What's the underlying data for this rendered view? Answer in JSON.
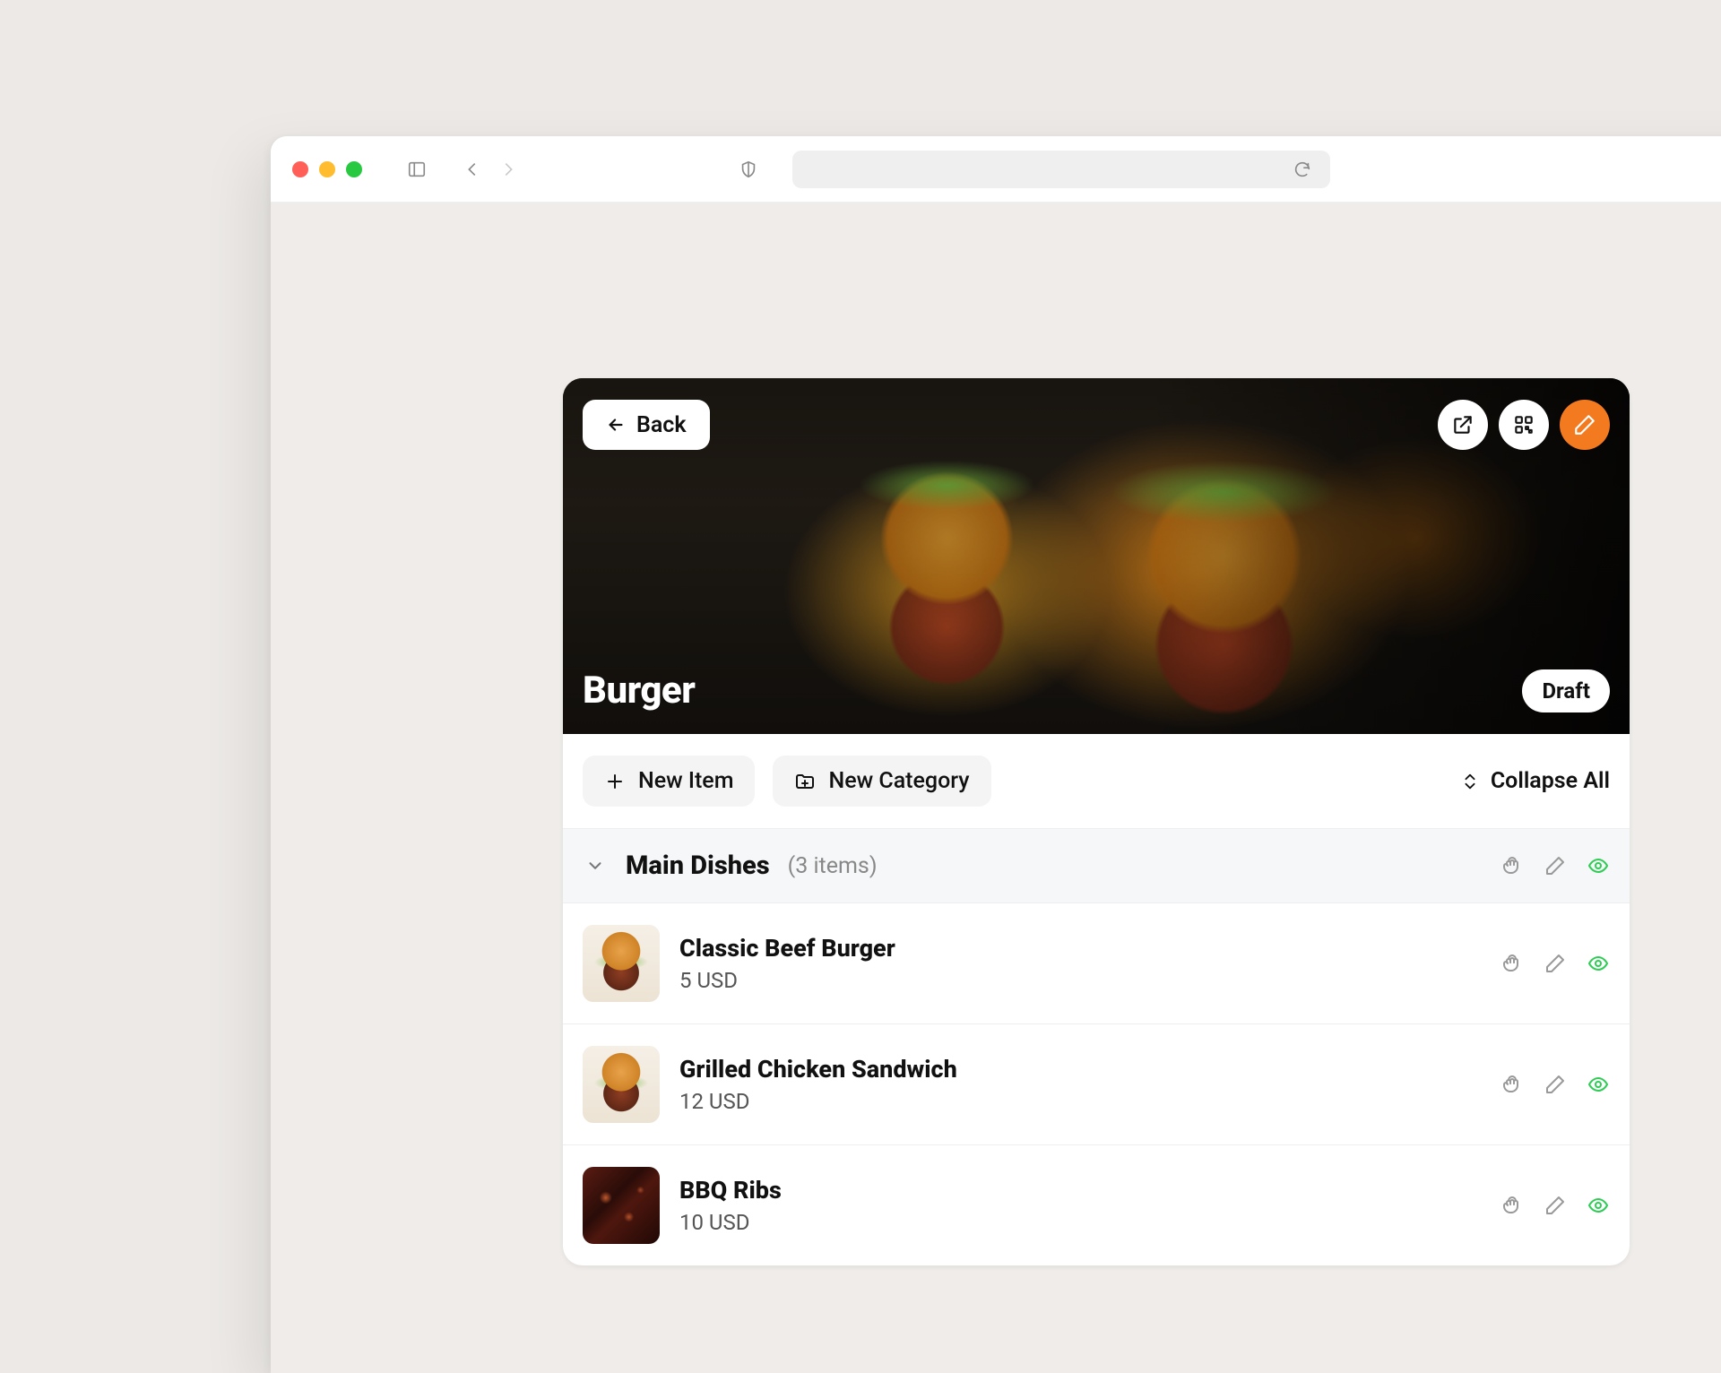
{
  "header": {
    "back_label": "Back",
    "title": "Burger",
    "status": "Draft"
  },
  "toolbar": {
    "new_item_label": "New Item",
    "new_category_label": "New Category",
    "collapse_all_label": "Collapse All"
  },
  "category": {
    "name": "Main Dishes",
    "count_label": "(3 items)"
  },
  "items": [
    {
      "name": "Classic Beef Burger",
      "price": "5 USD"
    },
    {
      "name": "Grilled Chicken Sandwich",
      "price": "12 USD"
    },
    {
      "name": "BBQ Ribs",
      "price": "10 USD"
    }
  ],
  "colors": {
    "accent": "#F47A1F",
    "visibility": "#2ecc55"
  }
}
